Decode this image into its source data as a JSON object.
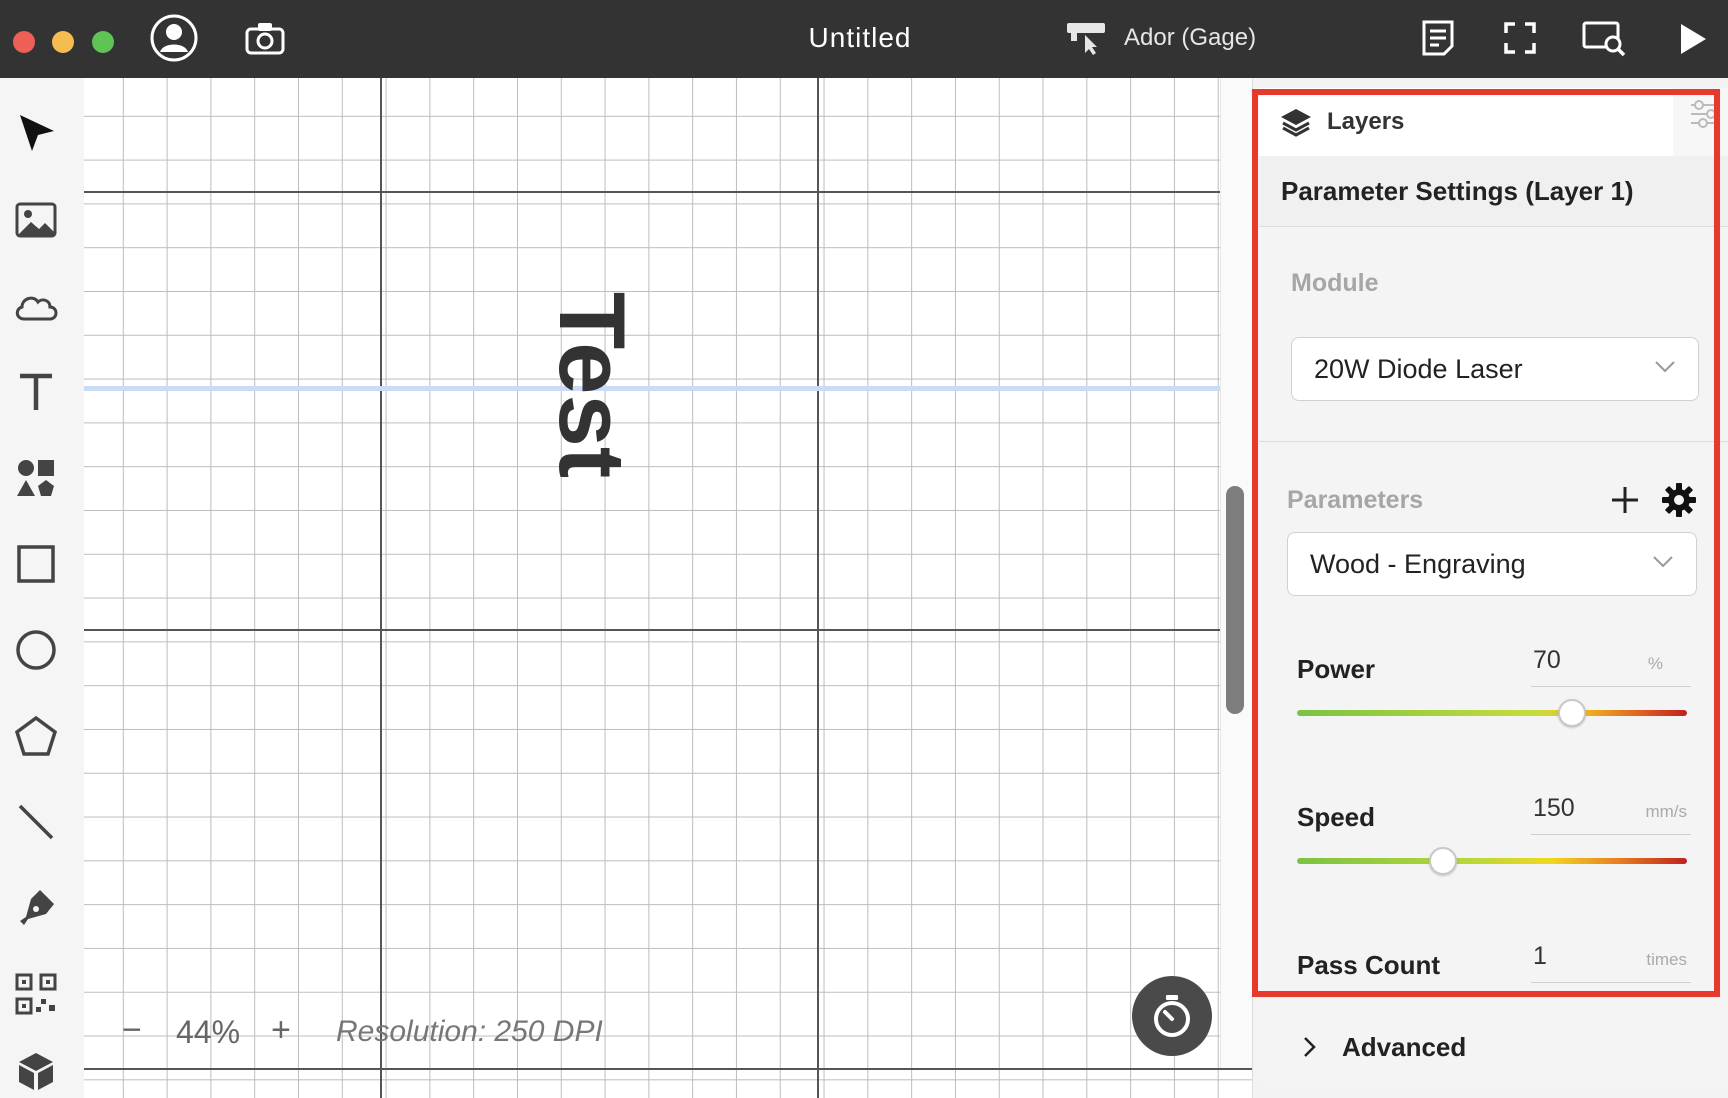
{
  "titlebar": {
    "document_title": "Untitled",
    "device_name": "Ador (Gage)"
  },
  "canvas": {
    "text_object": "Test",
    "zoom": "44%",
    "zoom_minus": "−",
    "zoom_plus": "+",
    "resolution": "Resolution: 250 DPI"
  },
  "panel": {
    "tab_label": "Layers",
    "header_title": "Parameter Settings (Layer 1)",
    "module_label": "Module",
    "module_value": "20W Diode Laser",
    "parameters_label": "Parameters",
    "preset_value": "Wood - Engraving",
    "power": {
      "label": "Power",
      "value": "70",
      "unit": "%",
      "slider_fraction": 0.7
    },
    "speed": {
      "label": "Speed",
      "value": "150",
      "unit": "mm/s",
      "slider_fraction": 0.37
    },
    "pass_count": {
      "label": "Pass Count",
      "value": "1",
      "unit": "times"
    },
    "advanced_label": "Advanced"
  },
  "colors": {
    "titlebar": "#333333",
    "highlight": "#e8392d",
    "guide": "#c9dbf7"
  }
}
